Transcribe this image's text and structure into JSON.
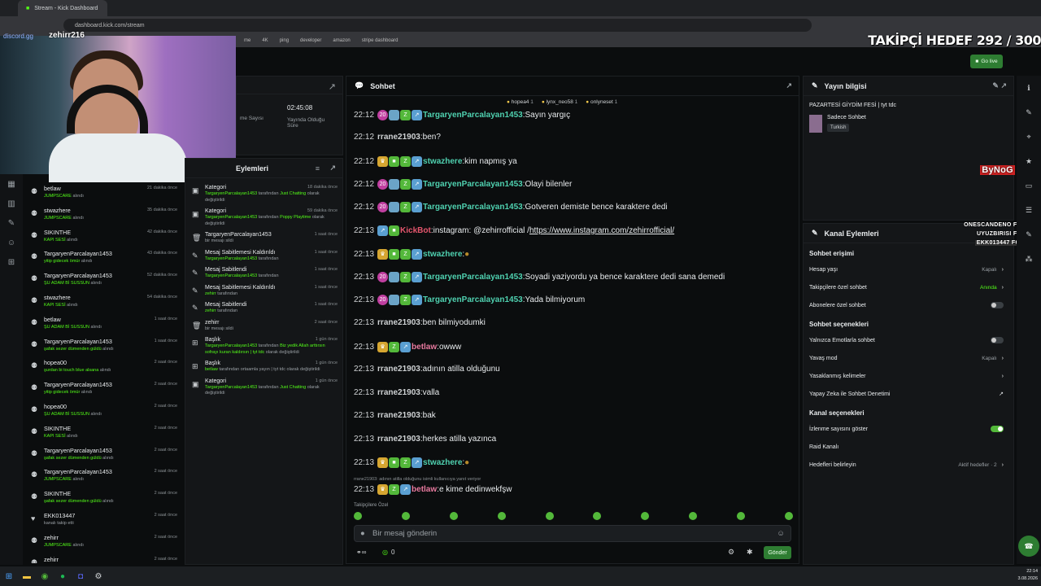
{
  "browser": {
    "tab_title": "Stream - Kick Dashboard",
    "url": "dashboard.kick.com/stream",
    "bookmarks": [
      "me",
      "4K",
      "ping",
      "developer",
      "amazon",
      "stripe dashboard"
    ]
  },
  "overlay": {
    "goal": "TAKİPÇİ HEDEF 292 / 300",
    "discord": "discord.gg",
    "streamer": "zehirr216",
    "right_lines": [
      "ONESCANDENO FOLLOW",
      "UYUZBIRISI FOLLOW",
      "EKK013447 FOLLOW"
    ],
    "logo": "ByNoG"
  },
  "topbar": {
    "go_live": "Go live"
  },
  "stats": {
    "time": "02:45:08",
    "time_label": "Yayında Olduğu Süre",
    "viewers_label": "me Sayısı"
  },
  "feed": [
    {
      "name": "betlaw",
      "sub": "JUMPSCARE",
      "tail": "alındı",
      "time": "21 dakika önce",
      "icon": "redeem"
    },
    {
      "name": "stwazhere",
      "sub": "JUMPSCARE",
      "tail": "alındı",
      "time": "35 dakika önce",
      "icon": "redeem"
    },
    {
      "name": "SIKINTHE",
      "sub": "KAPI SESİ",
      "tail": "alındı",
      "time": "42 dakika önce",
      "icon": "redeem"
    },
    {
      "name": "TargaryenParcalayan1453",
      "sub": "yitip gidecek ömür",
      "tail": "alındı",
      "time": "43 dakika önce",
      "icon": "redeem"
    },
    {
      "name": "TargaryenParcalayan1453",
      "sub": "ŞU ADAM Bİ SUSSUN",
      "tail": "alındı",
      "time": "52 dakika önce",
      "icon": "redeem"
    },
    {
      "name": "stwazhere",
      "sub": "KAPI SESİ",
      "tail": "alındı",
      "time": "54 dakika önce",
      "icon": "redeem"
    },
    {
      "name": "betlaw",
      "sub": "ŞU ADAM Bİ SUSSUN",
      "tail": "alındı",
      "time": "1 saat önce",
      "icon": "redeem"
    },
    {
      "name": "TargaryenParcalayan1453",
      "sub": "şafak sezer dümenden güldü",
      "tail": "alındı",
      "time": "1 saat önce",
      "icon": "redeem"
    },
    {
      "name": "hopea00",
      "sub": "şurdan bi touch blue alsana",
      "tail": "alındı",
      "time": "2 saat önce",
      "icon": "redeem"
    },
    {
      "name": "TargaryenParcalayan1453",
      "sub": "yitip gidecek ömür",
      "tail": "alındı",
      "time": "2 saat önce",
      "icon": "redeem"
    },
    {
      "name": "hopea00",
      "sub": "ŞU ADAM Bİ SUSSUN",
      "tail": "alındı",
      "time": "2 saat önce",
      "icon": "redeem"
    },
    {
      "name": "SIKINTHE",
      "sub": "KAPI SESİ",
      "tail": "alındı",
      "time": "2 saat önce",
      "icon": "redeem"
    },
    {
      "name": "TargaryenParcalayan1453",
      "sub": "şafak sezer dümenden güldü",
      "tail": "alındı",
      "time": "2 saat önce",
      "icon": "redeem"
    },
    {
      "name": "TargaryenParcalayan1453",
      "sub": "JUMPSCARE",
      "tail": "alındı",
      "time": "2 saat önce",
      "icon": "redeem"
    },
    {
      "name": "SIKINTHE",
      "sub": "şafak sezer dümenden güldü",
      "tail": "alındı",
      "time": "2 saat önce",
      "icon": "redeem"
    },
    {
      "name": "EKK013447",
      "sub": "",
      "tail": "kanalı takip etti",
      "time": "2 saat önce",
      "icon": "heart"
    },
    {
      "name": "zehirr",
      "sub": "JUMPSCARE",
      "tail": "alındı",
      "time": "2 saat önce",
      "icon": "redeem"
    },
    {
      "name": "zehirr",
      "sub": "",
      "tail": "",
      "time": "2 saat önce",
      "icon": "redeem"
    }
  ],
  "actions": {
    "title": "Eylemleri",
    "items": [
      {
        "title": "Kategori",
        "who": "TargaryenParcalayan1453",
        "mid": "tarafından",
        "val": "Just Chatting",
        "tail": "olarak değiştirildi",
        "time": "18 dakika önce",
        "icon": "cat"
      },
      {
        "title": "Kategori",
        "who": "TargaryenParcalayan1453",
        "mid": "tarafından",
        "val": "Poppy Playtime",
        "tail": "olarak değiştirildi",
        "time": "59 dakika önce",
        "icon": "cat"
      },
      {
        "title": "TargaryenParcalayan1453",
        "who": "",
        "mid": "",
        "val": "",
        "tail": "bir mesajı sildi",
        "time": "1 saat önce",
        "icon": "trash"
      },
      {
        "title": "Mesaj Sabitlemesi Kaldırıldı",
        "who": "TargaryenParcalayan1453",
        "mid": "tarafından",
        "val": "",
        "tail": "",
        "time": "1 saat önce",
        "icon": "pin"
      },
      {
        "title": "Mesaj Sabitlendi",
        "who": "TargaryenParcalayan1453",
        "mid": "tarafından",
        "val": "",
        "tail": "",
        "time": "1 saat önce",
        "icon": "pin"
      },
      {
        "title": "Mesaj Sabitlemesi Kaldırıldı",
        "who": "zehirr",
        "mid": "tarafından",
        "val": "",
        "tail": "",
        "time": "1 saat önce",
        "icon": "pin"
      },
      {
        "title": "Mesaj Sabitlendi",
        "who": "zehirr",
        "mid": "tarafından",
        "val": "",
        "tail": "",
        "time": "1 saat önce",
        "icon": "pin"
      },
      {
        "title": "zehirr",
        "who": "",
        "mid": "",
        "val": "",
        "tail": "bir mesajı sildi",
        "time": "2 saat önce",
        "icon": "trash"
      },
      {
        "title": "Başlık",
        "who": "TargaryenParcalayan1453",
        "mid": "tarafından",
        "val": "Biz yedik Allah arttırsın sofrayı kuran kaldırsın | tyt tdc",
        "tail": "olarak değiştirildi",
        "time": "1 gün önce",
        "icon": "title"
      },
      {
        "title": "Başlık",
        "who": "betlaw",
        "mid": "tarafından",
        "val": "",
        "tail": "ortaamla yayın | tyt tdc olarak değiştirildi",
        "time": "1 gün önce",
        "icon": "title"
      },
      {
        "title": "Kategori",
        "who": "TargaryenParcalayan1453",
        "mid": "tarafından",
        "val": "Just Chatting",
        "tail": "olarak değiştirildi",
        "time": "1 gün önce",
        "icon": "cat"
      }
    ]
  },
  "chat": {
    "title": "Sohbet",
    "pinned": [
      {
        "n": "1",
        "u": "hopea4"
      },
      {
        "n": "1",
        "u": "lynx_neo58"
      },
      {
        "n": "1",
        "u": "onlyneset"
      }
    ],
    "messages": [
      {
        "t": "22:12",
        "b": [
          "b20",
          "bsub",
          "bz",
          "bs"
        ],
        "u": "TargaryenParcalayan1453",
        "c": "#4fd1b0",
        "m": "Sayın yargıç"
      },
      {
        "t": "22:12",
        "b": [],
        "u": "rrane21903",
        "c": "#cfd2d4",
        "m": "ben?"
      },
      {
        "t": "22:12",
        "b": [
          "bk",
          "bg",
          "bz",
          "bs"
        ],
        "u": "stwazhere",
        "c": "#4fd1b0",
        "m": "kim napmış ya"
      },
      {
        "t": "22:12",
        "b": [
          "b20",
          "bsub",
          "bz",
          "bs"
        ],
        "u": "TargaryenParcalayan1453",
        "c": "#4fd1b0",
        "m": "Olayi bilenler"
      },
      {
        "t": "22:12",
        "b": [
          "b20",
          "bsub",
          "bz",
          "bs"
        ],
        "u": "TargaryenParcalayan1453",
        "c": "#4fd1b0",
        "m": "Gotveren demiste bence karaktere dedi"
      },
      {
        "t": "22:13",
        "b": [
          "bs",
          "bg"
        ],
        "u": "KickBot",
        "c": "#e4566d",
        "m": "instagram: @zehirrofficial / ",
        "link": "https://www.instagram.com/zehirrofficial/"
      },
      {
        "t": "22:13",
        "b": [
          "bk",
          "bg",
          "bz",
          "bs"
        ],
        "u": "stwazhere",
        "c": "#4fd1b0",
        "m": ""
      },
      {
        "t": "22:13",
        "b": [
          "b20",
          "bsub",
          "bz",
          "bs"
        ],
        "u": "TargaryenParcalayan1453",
        "c": "#4fd1b0",
        "m": "Soyadi yaziyordu ya bence karaktere dedi sana demedi"
      },
      {
        "t": "22:13",
        "b": [
          "b20",
          "bsub",
          "bz",
          "bs"
        ],
        "u": "TargaryenParcalayan1453",
        "c": "#4fd1b0",
        "m": "Yada bilmiyorum"
      },
      {
        "t": "22:13",
        "b": [],
        "u": "rrane21903",
        "c": "#cfd2d4",
        "m": "ben bilmiyodumki"
      },
      {
        "t": "22:13",
        "b": [
          "bk",
          "bz",
          "bs"
        ],
        "u": "betlaw",
        "c": "#e87a9f",
        "m": "owww"
      },
      {
        "t": "22:13",
        "b": [],
        "u": "rrane21903",
        "c": "#cfd2d4",
        "m": "adının atilla olduğunu"
      },
      {
        "t": "22:13",
        "b": [],
        "u": "rrane21903",
        "c": "#cfd2d4",
        "m": "valla"
      },
      {
        "t": "22:13",
        "b": [],
        "u": "rrane21903",
        "c": "#cfd2d4",
        "m": "bak"
      },
      {
        "t": "22:13",
        "b": [],
        "u": "rrane21903",
        "c": "#cfd2d4",
        "m": "herkes atilla yazınca"
      },
      {
        "t": "22:13",
        "b": [
          "bk",
          "bg",
          "bz",
          "bs"
        ],
        "u": "stwazhere",
        "c": "#4fd1b0",
        "m": ""
      },
      {
        "t": "22:13",
        "b": [
          "bk",
          "bz",
          "bs"
        ],
        "u": "betlaw",
        "c": "#e87a9f",
        "m": "e kime dedinwekfşw"
      }
    ],
    "reply_hint": "rrane21903: adının atilla olduğunu isimli kullanıcıya yanıt veriyor",
    "followers_only": "Takipçilere Özel",
    "placeholder": "Bir mesaj gönderin",
    "points": "0",
    "send": "Gönder"
  },
  "stream_info": {
    "title": "Yayın bilgisi",
    "stream_title": "PAZARTESİ GİYDİM FESİ | tyt tdc",
    "category": "Sadece Sohbet",
    "language": "Turkish"
  },
  "channel_actions": {
    "title": "Kanal Eylemleri",
    "sections": [
      {
        "name": "Sohbet erişimi",
        "rows": [
          {
            "label": "Hesap yaşı",
            "value": "Kapalı",
            "kind": "arrow"
          },
          {
            "label": "Takipçilere özel sohbet",
            "value": "Anında",
            "kind": "arrow",
            "green": true
          },
          {
            "label": "Abonelere özel sohbet",
            "value": "",
            "kind": "toggle",
            "on": false
          }
        ]
      },
      {
        "name": "Sohbet seçenekleri",
        "rows": [
          {
            "label": "Yalnızca Emotlarla sohbet",
            "value": "",
            "kind": "toggle",
            "on": false
          },
          {
            "label": "Yavaş mod",
            "value": "Kapalı",
            "kind": "arrow"
          },
          {
            "label": "Yasaklanmış kelimeler",
            "value": "",
            "kind": "arrow"
          },
          {
            "label": "Yapay Zeka ile Sohbet Denetimi",
            "value": "",
            "kind": "ext"
          }
        ]
      },
      {
        "name": "Kanal seçenekleri",
        "rows": [
          {
            "label": "İzlenme sayısını göster",
            "value": "",
            "kind": "toggle",
            "on": true
          },
          {
            "label": "Raid Kanalı",
            "value": "",
            "kind": "none"
          },
          {
            "label": "Hedefleri belirleyin",
            "value": "Aktif hedefler · 2",
            "kind": "arrow"
          }
        ]
      }
    ]
  },
  "taskbar": {
    "time": "22:14",
    "date": "3.08.2026"
  }
}
